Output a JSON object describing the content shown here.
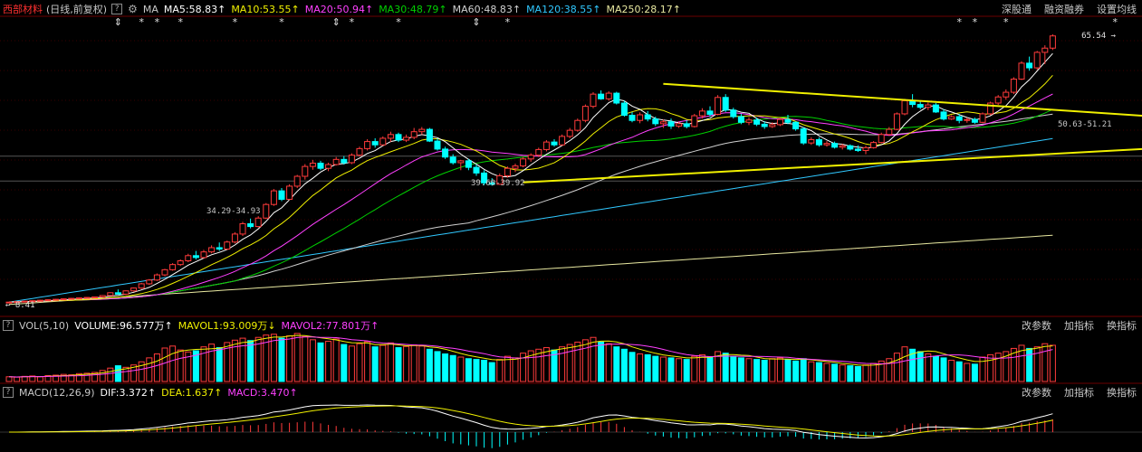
{
  "header": {
    "stock_name": "西部材料",
    "period": "(日线,前复权)",
    "help": "?",
    "ma_label": "MA",
    "ma_items": [
      {
        "text": "MA5:58.83",
        "arrow": "↑",
        "color": "#ffffff"
      },
      {
        "text": "MA10:53.55",
        "arrow": "↑",
        "color": "#f0f000"
      },
      {
        "text": "MA20:50.94",
        "arrow": "↑",
        "color": "#ff40ff"
      },
      {
        "text": "MA30:48.79",
        "arrow": "↑",
        "color": "#00d000"
      },
      {
        "text": "MA60:48.83",
        "arrow": "↑",
        "color": "#d0d0d0"
      },
      {
        "text": "MA120:38.55",
        "arrow": "↑",
        "color": "#30c8ff"
      },
      {
        "text": "MA250:28.17",
        "arrow": "↑",
        "color": "#e8e8a0"
      }
    ],
    "right_links": [
      "深股通",
      "融资融券",
      "设置均线"
    ]
  },
  "price_chart": {
    "high_label": "65.54",
    "low_label": "8.41",
    "annotations": [
      "39.60-39.92",
      "34.29-34.93",
      "50.63-51.21"
    ]
  },
  "volume_panel": {
    "label": "VOL(5,10)",
    "volume": "VOLUME:96.577万",
    "mavol1": "MAVOL1:93.009万",
    "mavol2": "MAVOL2:77.801万",
    "arrows": [
      "↑",
      "↓",
      "↑"
    ],
    "links": [
      "改参数",
      "加指标",
      "换指标"
    ]
  },
  "macd_panel": {
    "label": "MACD(12,26,9)",
    "dif": "DIF:3.372",
    "dea": "DEA:1.637",
    "macd": "MACD:3.470",
    "arrows": [
      "↑",
      "↑",
      "↑"
    ],
    "links": [
      "改参数",
      "加指标",
      "换指标"
    ]
  },
  "colors": {
    "up": "#ff3b3b",
    "down": "#00ffff",
    "ma5": "#ffffff",
    "ma10": "#f0f000",
    "ma20": "#ff40ff",
    "ma30": "#00d000",
    "ma60": "#d0d0d0",
    "ma120": "#30c8ff",
    "ma250": "#e8e8a0",
    "trendline": "#f0f000",
    "grid": "#3a0000"
  },
  "chart_data": {
    "type": "candlestick",
    "ohlc": [
      [
        8.4,
        8.6,
        8.3,
        8.5
      ],
      [
        8.5,
        8.7,
        8.4,
        8.6
      ],
      [
        8.6,
        8.8,
        8.5,
        8.7
      ],
      [
        8.7,
        8.9,
        8.6,
        8.8
      ],
      [
        8.8,
        9.0,
        8.7,
        8.9
      ],
      [
        8.9,
        9.1,
        8.8,
        9.0
      ],
      [
        9.0,
        9.2,
        8.9,
        9.1
      ],
      [
        9.1,
        9.3,
        9.0,
        9.2
      ],
      [
        9.2,
        9.4,
        9.1,
        9.3
      ],
      [
        9.3,
        9.5,
        9.2,
        9.4
      ],
      [
        9.4,
        9.6,
        9.3,
        9.5
      ],
      [
        9.5,
        9.7,
        9.4,
        9.6
      ],
      [
        9.6,
        10.0,
        9.5,
        9.9
      ],
      [
        9.9,
        10.6,
        9.8,
        10.5
      ],
      [
        10.5,
        11.2,
        10.4,
        10.2
      ],
      [
        10.2,
        11.0,
        10.0,
        10.9
      ],
      [
        10.9,
        11.6,
        10.7,
        11.5
      ],
      [
        11.5,
        12.6,
        11.3,
        12.4
      ],
      [
        12.4,
        13.4,
        12.2,
        13.2
      ],
      [
        13.2,
        14.6,
        13.0,
        14.3
      ],
      [
        14.3,
        15.6,
        14.0,
        15.4
      ],
      [
        15.4,
        16.8,
        15.2,
        16.5
      ],
      [
        16.5,
        17.6,
        16.2,
        17.3
      ],
      [
        17.3,
        18.8,
        17.0,
        18.4
      ],
      [
        18.4,
        19.4,
        17.6,
        18.0
      ],
      [
        18.0,
        19.6,
        17.8,
        19.2
      ],
      [
        19.2,
        20.6,
        18.9,
        20.1
      ],
      [
        20.1,
        21.2,
        19.4,
        19.8
      ],
      [
        19.8,
        21.6,
        19.6,
        21.3
      ],
      [
        21.3,
        23.4,
        21.0,
        23.0
      ],
      [
        23.0,
        25.6,
        22.6,
        25.2
      ],
      [
        25.2,
        26.3,
        24.2,
        24.6
      ],
      [
        24.6,
        26.8,
        24.4,
        26.4
      ],
      [
        26.4,
        29.6,
        26.2,
        29.3
      ],
      [
        29.3,
        32.6,
        29.0,
        32.2
      ],
      [
        32.2,
        32.8,
        30.0,
        30.4
      ],
      [
        30.4,
        33.6,
        30.2,
        33.2
      ],
      [
        33.2,
        35.6,
        32.8,
        35.3
      ],
      [
        35.3,
        37.9,
        34.6,
        37.4
      ],
      [
        37.4,
        38.8,
        36.7,
        38.1
      ],
      [
        38.1,
        38.6,
        36.6,
        37.0
      ],
      [
        37.0,
        38.2,
        36.4,
        37.8
      ],
      [
        37.8,
        39.4,
        37.6,
        38.9
      ],
      [
        38.9,
        39.6,
        37.8,
        38.2
      ],
      [
        38.2,
        40.2,
        37.9,
        39.8
      ],
      [
        39.8,
        41.6,
        39.5,
        41.2
      ],
      [
        41.2,
        43.2,
        40.8,
        42.7
      ],
      [
        42.7,
        43.4,
        41.4,
        42.0
      ],
      [
        42.0,
        43.8,
        41.8,
        43.4
      ],
      [
        43.4,
        44.8,
        42.6,
        44.2
      ],
      [
        44.2,
        44.6,
        42.6,
        43.0
      ],
      [
        43.0,
        44.2,
        42.6,
        43.6
      ],
      [
        43.6,
        45.6,
        43.2,
        44.8
      ],
      [
        44.8,
        45.8,
        44.2,
        45.3
      ],
      [
        45.3,
        45.6,
        42.6,
        42.8
      ],
      [
        42.8,
        43.4,
        40.8,
        41.1
      ],
      [
        41.1,
        41.6,
        39.0,
        39.4
      ],
      [
        39.4,
        40.0,
        37.8,
        38.2
      ],
      [
        38.2,
        38.8,
        36.6,
        38.6
      ],
      [
        38.6,
        39.0,
        36.6,
        37.2
      ],
      [
        37.2,
        37.8,
        35.4,
        36.0
      ],
      [
        36.0,
        36.6,
        33.4,
        33.9
      ],
      [
        33.9,
        34.9,
        33.3,
        33.6
      ],
      [
        33.6,
        35.9,
        33.5,
        35.4
      ],
      [
        35.4,
        37.4,
        35.0,
        37.0
      ],
      [
        37.0,
        38.0,
        36.2,
        37.5
      ],
      [
        37.5,
        39.4,
        37.2,
        39.0
      ],
      [
        39.0,
        40.2,
        38.4,
        39.8
      ],
      [
        39.8,
        41.4,
        39.4,
        41.0
      ],
      [
        41.0,
        43.0,
        40.6,
        42.6
      ],
      [
        42.6,
        43.2,
        41.6,
        42.0
      ],
      [
        42.0,
        44.2,
        41.8,
        43.8
      ],
      [
        43.8,
        45.6,
        43.4,
        45.1
      ],
      [
        45.1,
        47.6,
        44.8,
        47.2
      ],
      [
        47.2,
        50.6,
        46.8,
        50.2
      ],
      [
        50.2,
        53.2,
        49.8,
        52.8
      ],
      [
        52.8,
        53.6,
        51.6,
        51.8
      ],
      [
        51.8,
        53.4,
        51.4,
        53.0
      ],
      [
        53.0,
        53.3,
        50.6,
        50.9
      ],
      [
        50.9,
        51.4,
        48.0,
        48.3
      ],
      [
        48.3,
        49.0,
        46.8,
        47.2
      ],
      [
        47.2,
        48.9,
        46.6,
        48.4
      ],
      [
        48.4,
        49.2,
        47.0,
        47.5
      ],
      [
        47.5,
        48.0,
        46.0,
        46.5
      ],
      [
        46.5,
        47.4,
        45.6,
        46.9
      ],
      [
        46.9,
        47.6,
        45.4,
        46.0
      ],
      [
        46.0,
        46.9,
        45.6,
        46.5
      ],
      [
        46.5,
        47.2,
        45.5,
        45.9
      ],
      [
        45.9,
        48.6,
        45.7,
        48.2
      ],
      [
        48.2,
        49.8,
        47.6,
        49.2
      ],
      [
        49.2,
        50.2,
        48.0,
        48.5
      ],
      [
        48.5,
        52.6,
        48.3,
        52.1
      ],
      [
        52.1,
        52.8,
        49.0,
        49.4
      ],
      [
        49.4,
        49.9,
        47.6,
        48.0
      ],
      [
        48.0,
        48.6,
        46.4,
        46.8
      ],
      [
        46.8,
        47.9,
        46.2,
        47.3
      ],
      [
        47.3,
        47.8,
        46.0,
        46.4
      ],
      [
        46.4,
        47.0,
        45.4,
        45.9
      ],
      [
        45.9,
        46.8,
        45.6,
        46.3
      ],
      [
        46.3,
        47.8,
        46.0,
        47.4
      ],
      [
        47.4,
        48.4,
        46.4,
        46.8
      ],
      [
        46.8,
        47.0,
        45.0,
        45.4
      ],
      [
        45.4,
        45.8,
        42.0,
        42.4
      ],
      [
        42.4,
        43.6,
        42.0,
        43.1
      ],
      [
        43.1,
        43.6,
        41.6,
        42.0
      ],
      [
        42.0,
        42.8,
        41.6,
        42.3
      ],
      [
        42.3,
        42.7,
        41.2,
        41.5
      ],
      [
        41.5,
        42.2,
        41.0,
        41.8
      ],
      [
        41.8,
        42.1,
        40.8,
        41.1
      ],
      [
        41.1,
        41.9,
        40.5,
        40.8
      ],
      [
        40.8,
        41.8,
        40.0,
        41.4
      ],
      [
        41.4,
        42.8,
        41.2,
        42.5
      ],
      [
        42.5,
        44.6,
        42.3,
        44.2
      ],
      [
        44.2,
        45.8,
        43.9,
        45.3
      ],
      [
        45.3,
        48.9,
        45.1,
        48.6
      ],
      [
        48.6,
        51.8,
        48.3,
        51.4
      ],
      [
        51.4,
        52.8,
        50.0,
        50.6
      ],
      [
        50.6,
        51.3,
        49.6,
        50.0
      ],
      [
        50.0,
        51.0,
        49.4,
        50.5
      ],
      [
        50.5,
        50.9,
        48.8,
        49.0
      ],
      [
        49.0,
        49.6,
        47.2,
        47.5
      ],
      [
        47.5,
        48.3,
        47.3,
        48.0
      ],
      [
        48.0,
        48.6,
        46.6,
        47.2
      ],
      [
        47.2,
        47.8,
        46.7,
        47.4
      ],
      [
        47.4,
        47.8,
        46.5,
        46.8
      ],
      [
        46.8,
        48.9,
        46.6,
        48.6
      ],
      [
        48.6,
        51.2,
        48.3,
        50.9
      ],
      [
        50.9,
        52.6,
        50.5,
        52.2
      ],
      [
        52.2,
        53.8,
        51.6,
        53.2
      ],
      [
        53.2,
        56.4,
        52.8,
        56.0
      ],
      [
        56.0,
        59.8,
        55.8,
        59.4
      ],
      [
        59.4,
        60.8,
        57.8,
        58.4
      ],
      [
        58.4,
        62.0,
        58.0,
        61.7
      ],
      [
        61.7,
        63.2,
        59.2,
        62.6
      ],
      [
        62.6,
        65.54,
        62.2,
        65.2
      ]
    ],
    "volume": [
      1.2,
      1.1,
      1.3,
      1.4,
      1.2,
      1.5,
      1.6,
      1.8,
      1.7,
      2.0,
      2.1,
      2.3,
      2.8,
      3.4,
      4.0,
      3.6,
      4.2,
      5.0,
      6.0,
      7.0,
      8.5,
      9.0,
      8.0,
      7.5,
      7.8,
      8.8,
      9.5,
      8.6,
      9.9,
      10.5,
      11.0,
      10.4,
      11.2,
      11.8,
      12.0,
      11.0,
      11.6,
      12.2,
      11.4,
      10.6,
      9.8,
      10.2,
      10.8,
      9.4,
      9.0,
      9.6,
      10.1,
      8.8,
      9.2,
      9.8,
      8.6,
      8.9,
      9.3,
      9.0,
      8.2,
      7.6,
      7.0,
      6.6,
      6.2,
      5.8,
      5.6,
      5.4,
      4.8,
      5.6,
      6.4,
      6.0,
      7.2,
      7.8,
      8.2,
      8.6,
      8.0,
      8.8,
      9.4,
      10.0,
      10.6,
      11.2,
      10.0,
      9.6,
      8.8,
      8.2,
      7.4,
      7.0,
      6.8,
      6.4,
      6.2,
      6.0,
      5.8,
      5.6,
      6.4,
      6.8,
      6.2,
      7.6,
      7.2,
      6.4,
      6.0,
      5.8,
      5.6,
      5.4,
      5.8,
      6.0,
      5.6,
      5.2,
      5.8,
      5.0,
      4.8,
      4.6,
      4.4,
      4.2,
      4.0,
      3.8,
      4.2,
      4.6,
      5.2,
      5.8,
      7.2,
      8.8,
      8.2,
      7.6,
      7.0,
      6.4,
      6.0,
      5.4,
      5.0,
      4.6,
      4.4,
      6.2,
      6.8,
      7.2,
      7.6,
      8.4,
      9.2,
      8.4,
      8.8,
      9.6,
      9.2
    ],
    "trendlines": [
      {
        "name": "upper",
        "start": [
          84,
          55.0
        ],
        "end": [
          160,
          46.6
        ]
      },
      {
        "name": "lower",
        "start": [
          66,
          34.0
        ],
        "end": [
          160,
          42.4
        ]
      }
    ],
    "price_range": [
      7.0,
      69.0
    ]
  }
}
